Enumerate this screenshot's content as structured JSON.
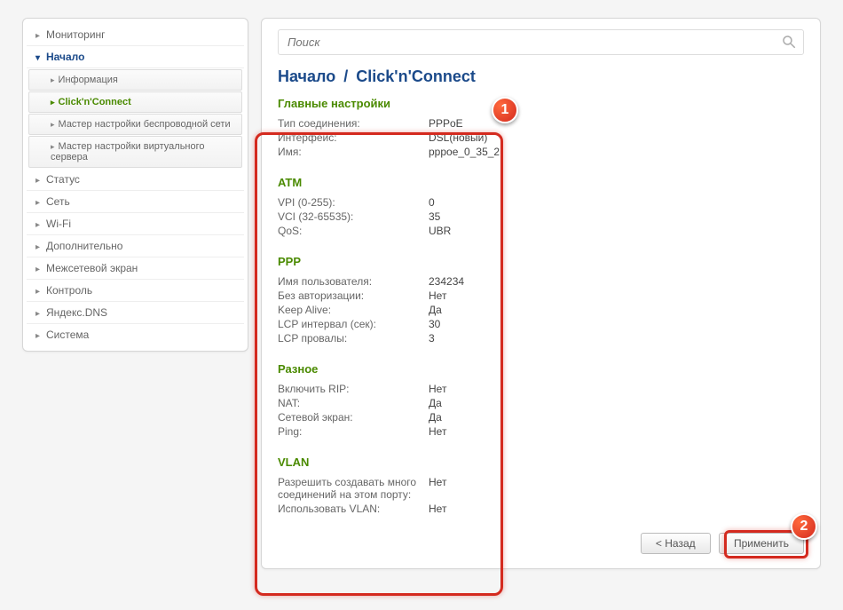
{
  "search": {
    "placeholder": "Поиск"
  },
  "breadcrumb": {
    "root": "Начало",
    "current": "Click'n'Connect"
  },
  "sidebar": {
    "items": [
      {
        "label": "Мониторинг",
        "key": "monitoring"
      },
      {
        "label": "Начало",
        "key": "start",
        "expanded": true,
        "children": [
          {
            "label": "Информация",
            "key": "info"
          },
          {
            "label": "Click'n'Connect",
            "key": "clicknconnect",
            "active": true
          },
          {
            "label": "Мастер настройки беспроводной сети",
            "key": "wifi-wizard"
          },
          {
            "label": "Мастер настройки виртуального сервера",
            "key": "vserver-wizard"
          }
        ]
      },
      {
        "label": "Статус",
        "key": "status"
      },
      {
        "label": "Сеть",
        "key": "network"
      },
      {
        "label": "Wi-Fi",
        "key": "wifi"
      },
      {
        "label": "Дополнительно",
        "key": "advanced"
      },
      {
        "label": "Межсетевой экран",
        "key": "firewall"
      },
      {
        "label": "Контроль",
        "key": "control"
      },
      {
        "label": "Яндекс.DNS",
        "key": "yandexdns"
      },
      {
        "label": "Система",
        "key": "system"
      }
    ]
  },
  "sections": [
    {
      "title": "Главные настройки",
      "rows": [
        {
          "k": "Тип соединения:",
          "v": "PPPoE"
        },
        {
          "k": "Интерфейс:",
          "v": "DSL(новый)"
        },
        {
          "k": "Имя:",
          "v": "pppoe_0_35_2"
        }
      ]
    },
    {
      "title": "ATM",
      "rows": [
        {
          "k": "VPI (0-255):",
          "v": "0"
        },
        {
          "k": "VCI (32-65535):",
          "v": "35"
        },
        {
          "k": "QoS:",
          "v": "UBR"
        }
      ]
    },
    {
      "title": "PPP",
      "rows": [
        {
          "k": "Имя пользователя:",
          "v": "234234"
        },
        {
          "k": "Без авторизации:",
          "v": "Нет"
        },
        {
          "k": "Keep Alive:",
          "v": "Да"
        },
        {
          "k": "LCP интервал (сек):",
          "v": "30"
        },
        {
          "k": "LCP провалы:",
          "v": "3"
        }
      ]
    },
    {
      "title": "Разное",
      "rows": [
        {
          "k": "Включить RIP:",
          "v": "Нет"
        },
        {
          "k": "NAT:",
          "v": "Да"
        },
        {
          "k": "Сетевой экран:",
          "v": "Да"
        },
        {
          "k": "Ping:",
          "v": "Нет"
        }
      ]
    },
    {
      "title": "VLAN",
      "rows": [
        {
          "k": "Разрешить создавать много соединений на этом порту:",
          "v": "Нет"
        },
        {
          "k": "Использовать VLAN:",
          "v": "Нет"
        }
      ]
    }
  ],
  "buttons": {
    "back": "< Назад",
    "apply": "Применить"
  },
  "annotations": {
    "badge1": "1",
    "badge2": "2"
  }
}
